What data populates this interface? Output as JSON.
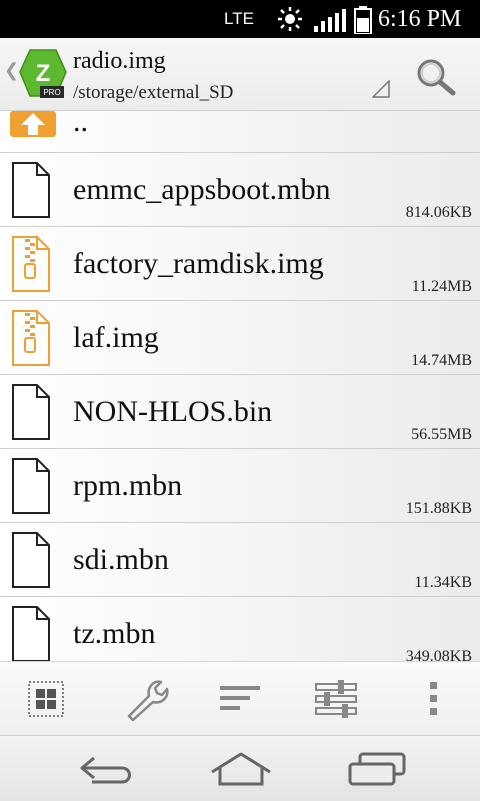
{
  "status_bar": {
    "network": "LTE",
    "time": "6:16 PM"
  },
  "header": {
    "title": "radio.img",
    "path": "/storage/external_SD",
    "logo_text": "PRO",
    "logo_letter": "Z"
  },
  "file_list": {
    "parent_label": "..",
    "items": [
      {
        "name": "emmc_appsboot.mbn",
        "size": "814.06KB",
        "icon": "document-icon"
      },
      {
        "name": "factory_ramdisk.img",
        "size": "11.24MB",
        "icon": "archive-icon"
      },
      {
        "name": "laf.img",
        "size": "14.74MB",
        "icon": "archive-icon"
      },
      {
        "name": "NON-HLOS.bin",
        "size": "56.55MB",
        "icon": "document-icon"
      },
      {
        "name": "rpm.mbn",
        "size": "151.88KB",
        "icon": "document-icon"
      },
      {
        "name": "sdi.mbn",
        "size": "11.34KB",
        "icon": "document-icon"
      },
      {
        "name": "tz.mbn",
        "size": "349.08KB",
        "icon": "document-icon"
      }
    ]
  },
  "toolbar": {
    "buttons": [
      "grid-view-icon",
      "wrench-icon",
      "sort-icon",
      "equalizer-icon",
      "overflow-menu-icon"
    ]
  },
  "navigation": {
    "buttons": [
      "back-icon",
      "home-icon",
      "recent-apps-icon"
    ]
  },
  "colors": {
    "accent_orange": "#f0a030",
    "logo_green": "#5cb82e"
  }
}
